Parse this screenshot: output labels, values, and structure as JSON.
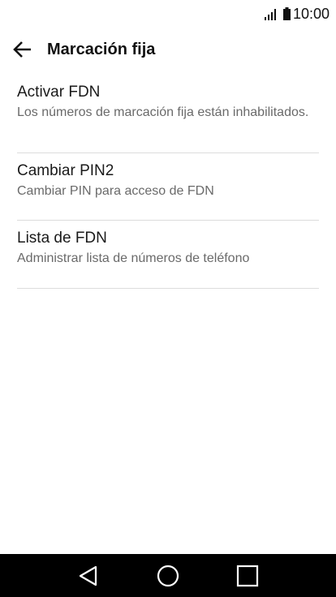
{
  "status_bar": {
    "time": "10:00",
    "signal_icon": "signal-icon",
    "battery_icon": "battery-icon"
  },
  "app_bar": {
    "back_icon": "back-arrow-icon",
    "title": "Marcación fija"
  },
  "settings": [
    {
      "title": "Activar FDN",
      "summary": "Los números de marcación fija están inhabilitados."
    },
    {
      "title": "Cambiar PIN2",
      "summary": "Cambiar PIN para acceso de FDN"
    },
    {
      "title": "Lista de FDN",
      "summary": "Administrar lista de números de teléfono"
    }
  ],
  "nav_bar": {
    "back_icon": "nav-back-icon",
    "home_icon": "nav-home-icon",
    "recents_icon": "nav-recents-icon"
  },
  "colors": {
    "background": "#ffffff",
    "divider": "#dcdcdc",
    "nav_bar": "#000000"
  }
}
